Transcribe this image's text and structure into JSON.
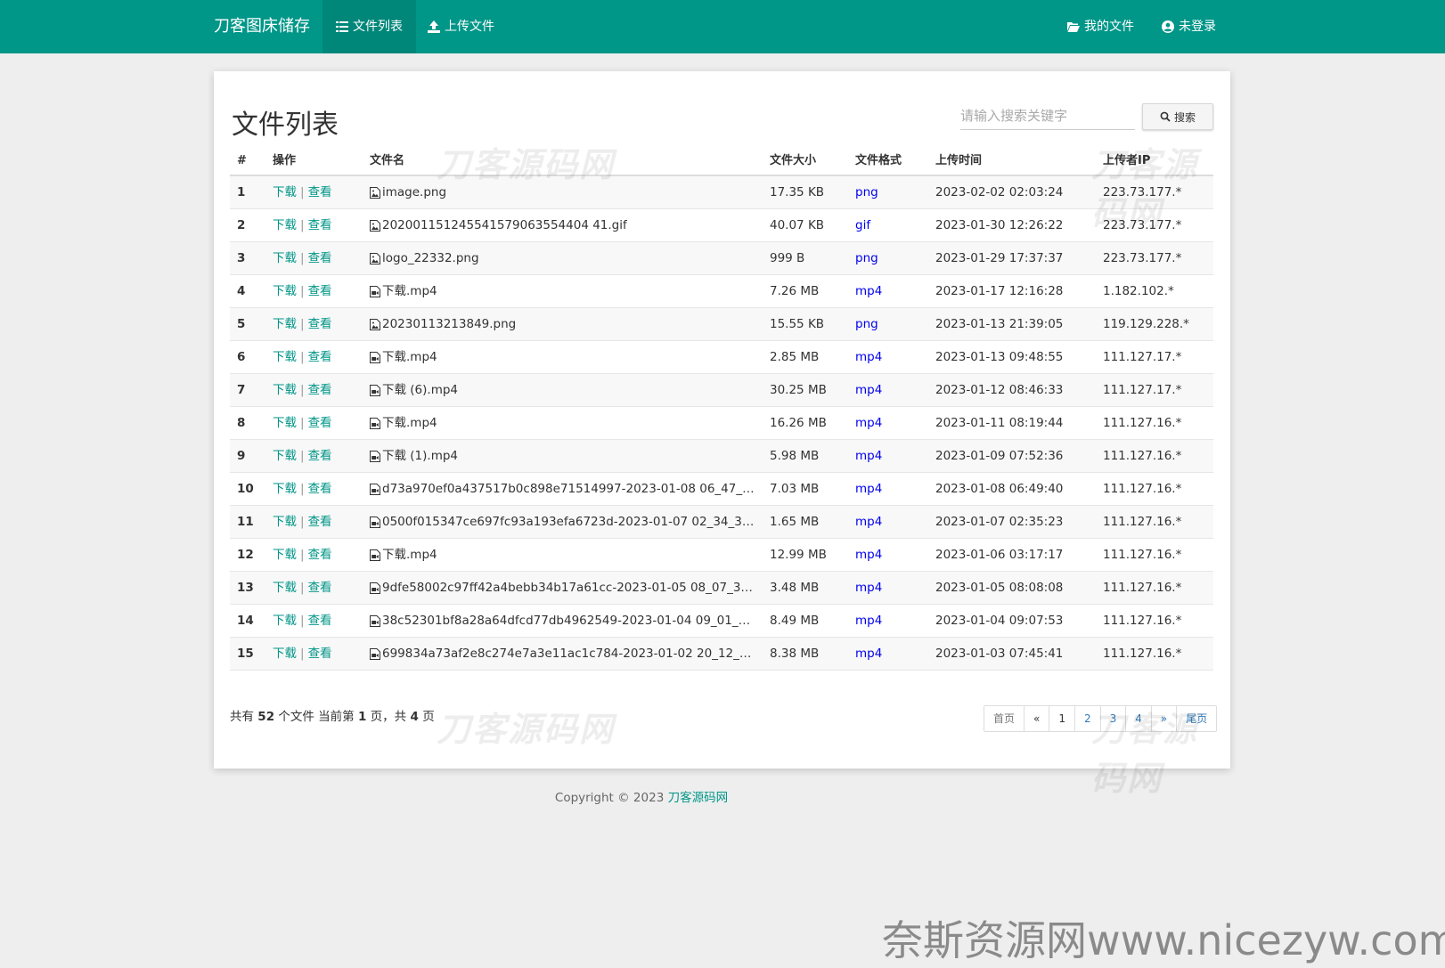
{
  "nav": {
    "brand": "刀客图床储存",
    "items": [
      {
        "label": "文件列表",
        "icon": "list-icon"
      },
      {
        "label": "上传文件",
        "icon": "upload-icon"
      }
    ],
    "right": [
      {
        "label": "我的文件",
        "icon": "folder-open-icon"
      },
      {
        "label": "未登录",
        "icon": "user-circle-icon"
      }
    ]
  },
  "page": {
    "title": "文件列表"
  },
  "search": {
    "placeholder": "请输入搜索关键字",
    "button_label": "搜索"
  },
  "table": {
    "headers": [
      "#",
      "操作",
      "文件名",
      "文件大小",
      "文件格式",
      "上传时间",
      "上传者IP"
    ],
    "download_label": "下载",
    "view_label": "查看",
    "rows": [
      {
        "num": "1",
        "name": "image.png",
        "size": "17.35 KB",
        "fmt": "png",
        "time": "2023-02-02 02:03:24",
        "ip": "223.73.177.*",
        "type": "image"
      },
      {
        "num": "2",
        "name": "202001151245541579063554404 41.gif",
        "size": "40.07 KB",
        "fmt": "gif",
        "time": "2023-01-30 12:26:22",
        "ip": "223.73.177.*",
        "type": "image"
      },
      {
        "num": "3",
        "name": "logo_22332.png",
        "size": "999 B",
        "fmt": "png",
        "time": "2023-01-29 17:37:37",
        "ip": "223.73.177.*",
        "type": "image"
      },
      {
        "num": "4",
        "name": "下载.mp4",
        "size": "7.26 MB",
        "fmt": "mp4",
        "time": "2023-01-17 12:16:28",
        "ip": "1.182.102.*",
        "type": "video"
      },
      {
        "num": "5",
        "name": "20230113213849.png",
        "size": "15.55 KB",
        "fmt": "png",
        "time": "2023-01-13 21:39:05",
        "ip": "119.129.228.*",
        "type": "image"
      },
      {
        "num": "6",
        "name": "下载.mp4",
        "size": "2.85 MB",
        "fmt": "mp4",
        "time": "2023-01-13 09:48:55",
        "ip": "111.127.17.*",
        "type": "video"
      },
      {
        "num": "7",
        "name": "下载 (6).mp4",
        "size": "30.25 MB",
        "fmt": "mp4",
        "time": "2023-01-12 08:46:33",
        "ip": "111.127.17.*",
        "type": "video"
      },
      {
        "num": "8",
        "name": "下载.mp4",
        "size": "16.26 MB",
        "fmt": "mp4",
        "time": "2023-01-11 08:19:44",
        "ip": "111.127.16.*",
        "type": "video"
      },
      {
        "num": "9",
        "name": "下载 (1).mp4",
        "size": "5.98 MB",
        "fmt": "mp4",
        "time": "2023-01-09 07:52:36",
        "ip": "111.127.16.*",
        "type": "video"
      },
      {
        "num": "10",
        "name": "d73a970ef0a437517b0c898e71514997-2023-01-08 06_47_26....",
        "size": "7.03 MB",
        "fmt": "mp4",
        "time": "2023-01-08 06:49:40",
        "ip": "111.127.16.*",
        "type": "video"
      },
      {
        "num": "11",
        "name": "0500f015347ce697fc93a193efa6723d-2023-01-07 02_34_32....",
        "size": "1.65 MB",
        "fmt": "mp4",
        "time": "2023-01-07 02:35:23",
        "ip": "111.127.16.*",
        "type": "video"
      },
      {
        "num": "12",
        "name": "下载.mp4",
        "size": "12.99 MB",
        "fmt": "mp4",
        "time": "2023-01-06 03:17:17",
        "ip": "111.127.16.*",
        "type": "video"
      },
      {
        "num": "13",
        "name": "9dfe58002c97ff42a4bebb34b17a61cc-2023-01-05 08_07_36....",
        "size": "3.48 MB",
        "fmt": "mp4",
        "time": "2023-01-05 08:08:08",
        "ip": "111.127.16.*",
        "type": "video"
      },
      {
        "num": "14",
        "name": "38c52301bf8a28a64dfcd77db4962549-2023-01-04 09_01_49....",
        "size": "8.49 MB",
        "fmt": "mp4",
        "time": "2023-01-04 09:07:53",
        "ip": "111.127.16.*",
        "type": "video"
      },
      {
        "num": "15",
        "name": "699834a73af2e8c274e7a3e11ac1c784-2023-01-02 20_12_16....",
        "size": "8.38 MB",
        "fmt": "mp4",
        "time": "2023-01-03 07:45:41",
        "ip": "111.127.16.*",
        "type": "video"
      }
    ]
  },
  "summary": {
    "prefix": "共有",
    "total": "52",
    "mid": "个文件  当前第",
    "current": "1",
    "mid2": "页，共",
    "pages": "4",
    "suffix": "页"
  },
  "pager": [
    "首页",
    "«",
    "1",
    "2",
    "3",
    "4",
    "»",
    "尾页"
  ],
  "footer": {
    "copyright": "Copyright © 2023",
    "link": "刀客源码网"
  },
  "watermark": {
    "text": "刀客源码网",
    "site": "奈斯资源网www.nicezyw.com"
  },
  "colors": {
    "primary": "#009688",
    "link_blue": "#0000ee"
  }
}
